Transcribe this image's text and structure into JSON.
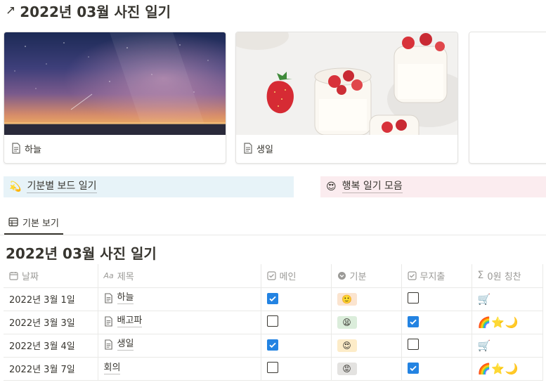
{
  "page_title": "2022년 03월 사진 일기",
  "gallery": [
    {
      "caption": "하늘",
      "image": "milky-way-night-sky"
    },
    {
      "caption": "생일",
      "image": "strawberry-panna-cotta"
    },
    {
      "caption": "",
      "image": "blank"
    }
  ],
  "callouts": [
    {
      "emoji": "💫",
      "label": "기분별 보드 일기",
      "bg": "#e7f3f8"
    },
    {
      "emoji": "😍",
      "label": "행복 일기 모음",
      "bg": "#fbecef"
    }
  ],
  "view_tab": {
    "label": "기본 보기"
  },
  "database_title": "2022년 03월 사진 일기",
  "columns": [
    {
      "label": "날짜",
      "icon": "calendar-icon"
    },
    {
      "label": "제목",
      "icon": "text-aa-icon"
    },
    {
      "label": "메인",
      "icon": "checkbox-icon"
    },
    {
      "label": "기분",
      "icon": "select-icon"
    },
    {
      "label": "무지출",
      "icon": "checkbox-icon"
    },
    {
      "label": "0원 칭찬",
      "icon": "formula-sigma-icon"
    }
  ],
  "rows": [
    {
      "date": "2022년 3월 1일",
      "title": "하늘",
      "has_page_icon": true,
      "main": true,
      "mood": "🙂",
      "mood_bg": "#fbe4cf",
      "no_spend": false,
      "praise": "🛒"
    },
    {
      "date": "2022년 3월 3일",
      "title": "배고파",
      "has_page_icon": true,
      "main": false,
      "mood": "😫",
      "mood_bg": "#dbeddb",
      "no_spend": true,
      "praise": "🌈⭐🌙"
    },
    {
      "date": "2022년 3월 4일",
      "title": "생일",
      "has_page_icon": true,
      "main": true,
      "mood": "😍",
      "mood_bg": "#fdecc8",
      "no_spend": false,
      "praise": "🛒"
    },
    {
      "date": "2022년 3월 7일",
      "title": "회의",
      "has_page_icon": false,
      "main": false,
      "mood": "😡",
      "mood_bg": "#e3e2e0",
      "no_spend": true,
      "praise": "🌈⭐🌙"
    }
  ]
}
